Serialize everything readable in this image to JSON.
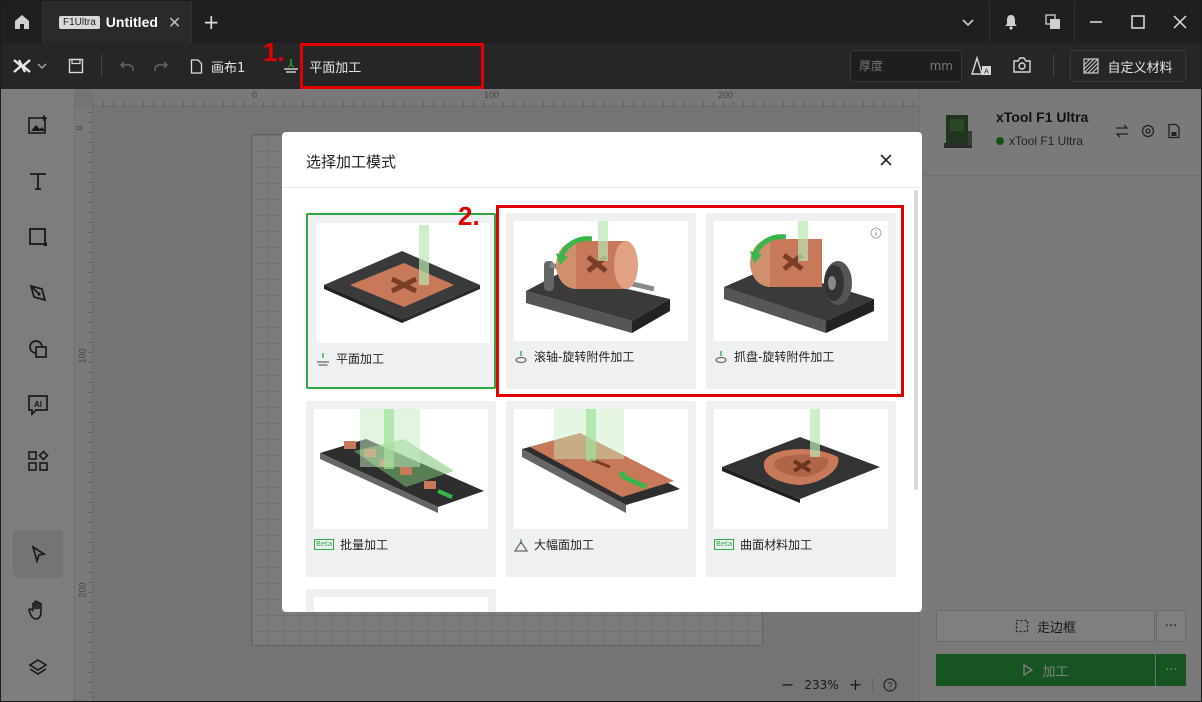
{
  "titlebar": {
    "tab_badge": "F1Ultra",
    "tab_title": "Untitled",
    "icons": [
      "home-icon",
      "close-icon",
      "plus-icon",
      "chevron-down-icon",
      "bell-icon",
      "windows-icon",
      "minimize-icon",
      "maximize-icon",
      "close-window-icon"
    ]
  },
  "toolbar": {
    "canvas_label": "画布1",
    "mode_label": "平面加工",
    "thickness_placeholder": "厚度",
    "thickness_unit": "mm",
    "custom_material": "自定义材料"
  },
  "rulers": {
    "h_ticks": [
      "0",
      "100",
      "200"
    ],
    "v_ticks": [
      "0",
      "100",
      "200"
    ]
  },
  "zoom": {
    "value": "233%"
  },
  "device": {
    "name": "xTool F1 Ultra",
    "status": "xTool F1 Ultra",
    "status_color": "#29a33b"
  },
  "actions": {
    "frame": "走边框",
    "process": "加工",
    "accent": "#2ca844"
  },
  "modal": {
    "title": "选择加工模式",
    "cards": [
      {
        "label": "平面加工",
        "selected": true,
        "icon": "flat-mode-icon"
      },
      {
        "label": "滚轴-旋转附件加工",
        "selected": false,
        "icon": "rotary-mode-icon"
      },
      {
        "label": "抓盘-旋转附件加工",
        "selected": false,
        "icon": "rotary-mode-icon",
        "info": true
      },
      {
        "label": "批量加工",
        "selected": false,
        "icon": "beta-badge",
        "badge": "Beta"
      },
      {
        "label": "大幅面加工",
        "selected": false,
        "icon": "large-mode-icon"
      },
      {
        "label": "曲面材料加工",
        "selected": false,
        "icon": "beta-badge",
        "badge": "Beta"
      }
    ]
  },
  "annotations": {
    "step1": "1.",
    "step2": "2.",
    "color": "#e00000"
  }
}
